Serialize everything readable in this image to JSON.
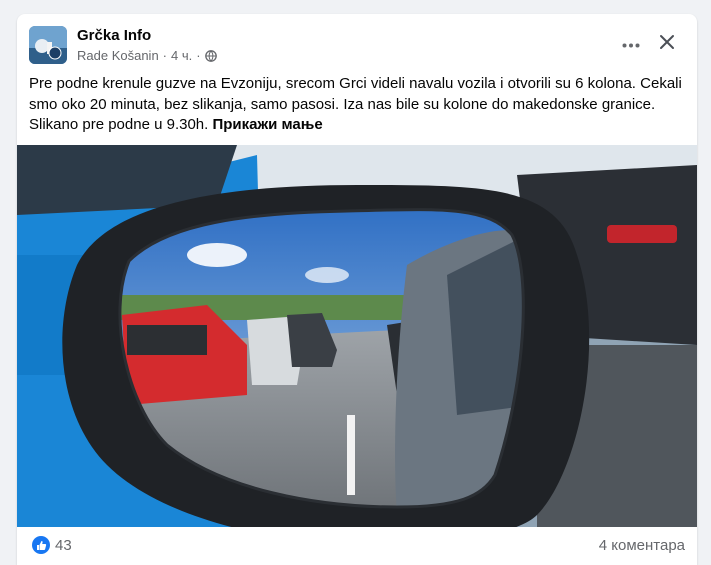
{
  "post": {
    "page_name": "Grčka Info",
    "author": "Rade Košanin",
    "separator": "·",
    "time": "4 ч.",
    "separator2": "·",
    "text": "Pre podne krenule guzve na Evzoniju, srecom Grci videli navalu vozila i otvorili su 6 kolona. Cekali smo oko 20 minuta, bez slikanja, samo pasosi. Iza nas bile su kolone do makedonske granice. Slikano pre podne u 9.30h.",
    "see_less": "Прикажи мање"
  },
  "reactions": {
    "like_count": "43",
    "comments": "4 коментара"
  },
  "icons": {
    "privacy": "globe-icon",
    "more": "more-options-icon",
    "close": "close-icon",
    "like": "like-thumb-icon"
  },
  "colors": {
    "accent": "#1877f2",
    "secondary_text": "#65676b"
  }
}
